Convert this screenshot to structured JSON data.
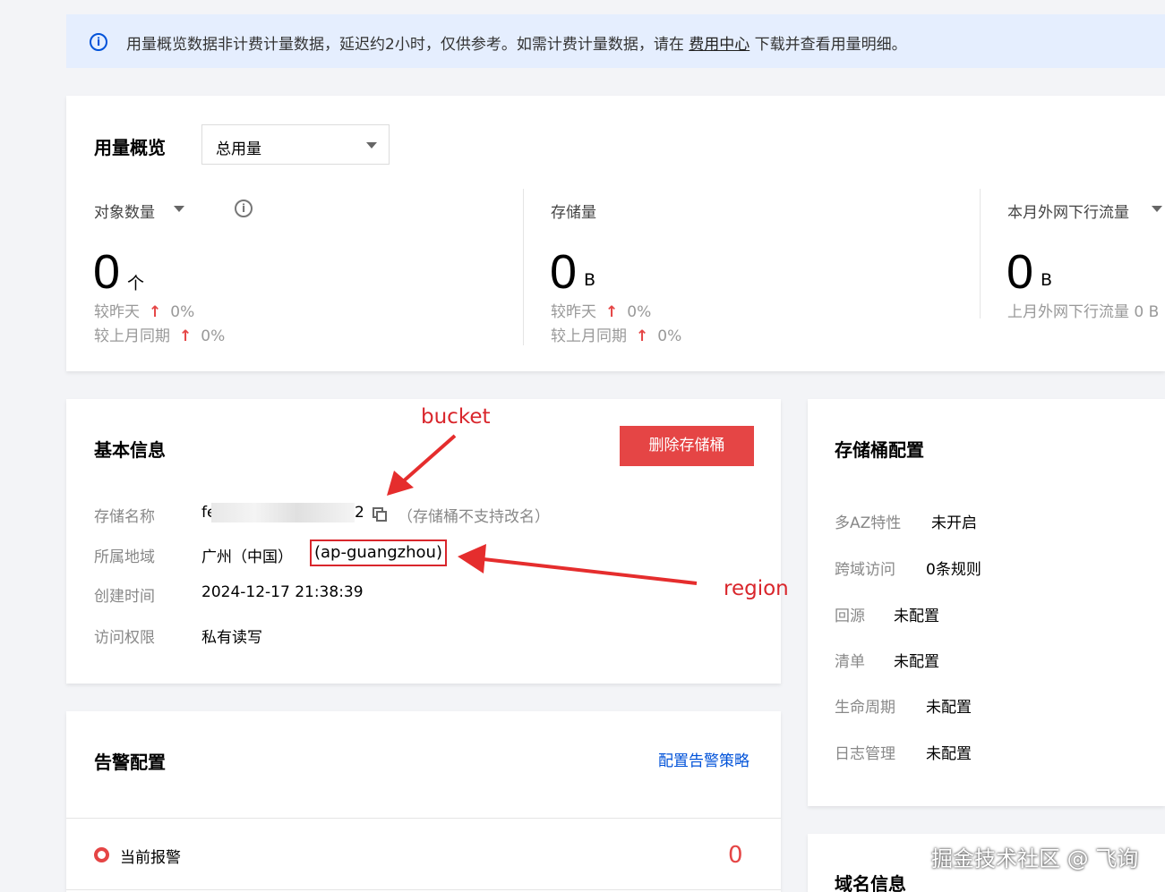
{
  "notice": {
    "text_before": "用量概览数据非计费计量数据，延迟约2小时，仅供参考。如需计费计量数据，请在 ",
    "link": "费用中心",
    "text_after": " 下载并查看用量明细。"
  },
  "usage": {
    "title": "用量概览",
    "select_value": "总用量",
    "metrics": [
      {
        "label": "对象数量",
        "value": "0",
        "unit": "个",
        "cmp_day_label": "较昨天",
        "cmp_day_value": "0%",
        "cmp_month_label": "较上月同期",
        "cmp_month_value": "0%"
      },
      {
        "label": "存储量",
        "value": "0",
        "unit": "B",
        "cmp_day_label": "较昨天",
        "cmp_day_value": "0%",
        "cmp_month_label": "较上月同期",
        "cmp_month_value": "0%"
      },
      {
        "label": "本月外网下行流量",
        "value": "0",
        "unit": "B",
        "last_month": "上月外网下行流量 0 B"
      }
    ]
  },
  "basic_info": {
    "title": "基本信息",
    "delete_button": "删除存储桶",
    "name_label": "存储名称",
    "name_prefix": "fe",
    "name_suffix": "2",
    "name_note": "（存储桶不支持改名）",
    "region_label": "所属地域",
    "region_value": "广州（中国）",
    "region_code": "(ap-guangzhou)",
    "created_label": "创建时间",
    "created_value": "2024-12-17 21:38:39",
    "access_label": "访问权限",
    "access_value": "私有读写"
  },
  "annotations": {
    "bucket": "bucket",
    "region": "region",
    "color": "#d9262c"
  },
  "bucket_config": {
    "title": "存储桶配置",
    "items": [
      {
        "label": "多AZ特性",
        "value": "未开启"
      },
      {
        "label": "跨域访问",
        "value": "0条规则"
      },
      {
        "label": "回源",
        "value": "未配置"
      },
      {
        "label": "清单",
        "value": "未配置"
      },
      {
        "label": "生命周期",
        "value": "未配置"
      },
      {
        "label": "日志管理",
        "value": "未配置"
      }
    ]
  },
  "alarm": {
    "title": "告警配置",
    "link": "配置告警策略",
    "current_label": "当前报警",
    "current_count": "0"
  },
  "domain": {
    "title": "域名信息"
  },
  "watermark": "掘金技术社区 @ 飞询",
  "colors": {
    "primary": "#0052d9",
    "danger": "#e54545",
    "notice_bg": "#e5eefe"
  }
}
